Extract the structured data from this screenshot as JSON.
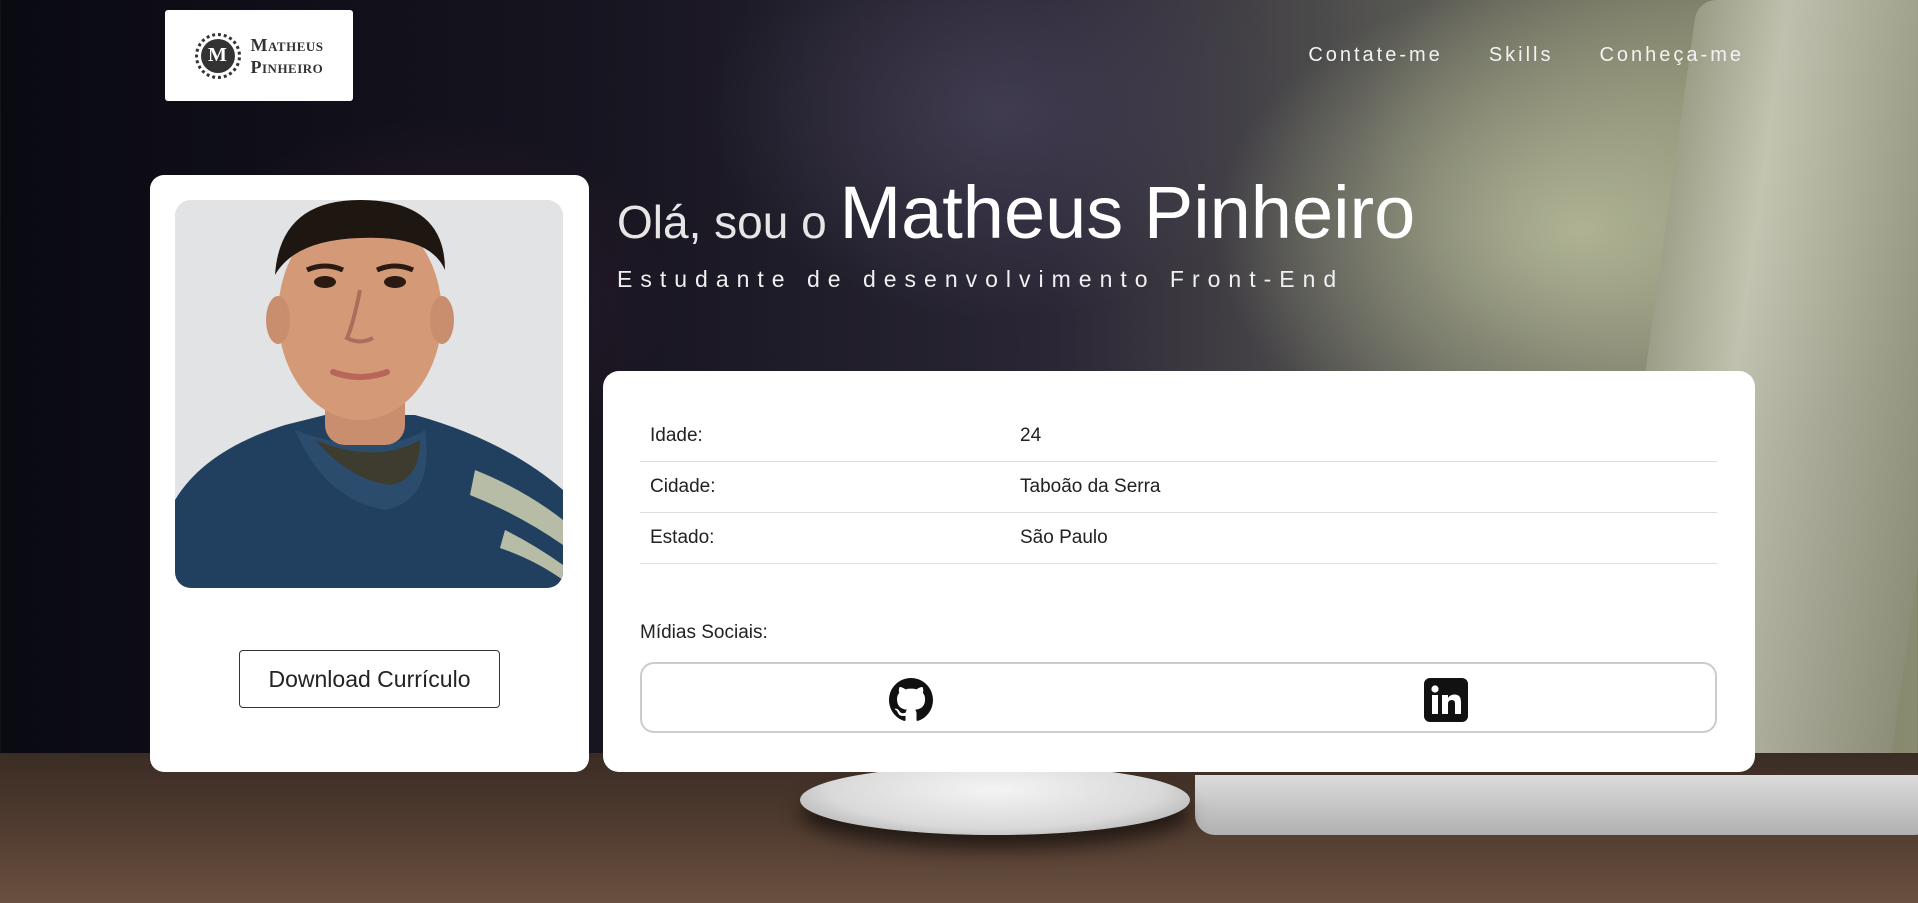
{
  "logo": {
    "initial": "M",
    "line1": "Matheus",
    "line2": "Pinheiro"
  },
  "nav": {
    "items": [
      "Contate-me",
      "Skills",
      "Conheça-me"
    ]
  },
  "hero": {
    "greeting_prefix": "Olá, sou o ",
    "name": "Matheus Pinheiro",
    "subtitle": "Estudante de desenvolvimento Front-End"
  },
  "profile": {
    "photo_icon": "profile-photo",
    "download_label": "Download Currículo"
  },
  "info": {
    "rows": [
      {
        "label": "Idade:",
        "value": "24"
      },
      {
        "label": "Cidade:",
        "value": "Taboão da Serra"
      },
      {
        "label": "Estado:",
        "value": "São Paulo"
      }
    ],
    "social_label": "Mídias Sociais:",
    "social_icons": [
      "github-icon",
      "linkedin-icon"
    ]
  },
  "colors": {
    "card_bg": "#ffffff",
    "text_dark": "#222222",
    "nav_text": "#f3f3f3"
  }
}
